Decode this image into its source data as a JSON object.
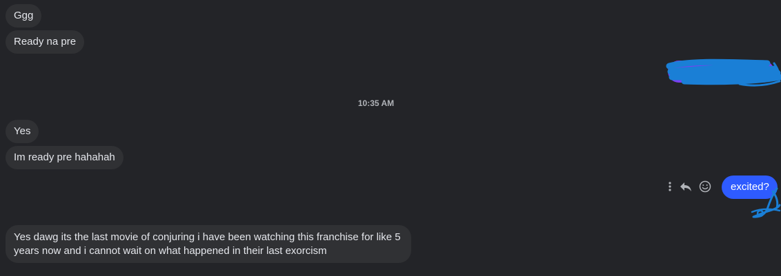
{
  "conversation": {
    "messages": [
      {
        "direction": "incoming",
        "text": "Ggg"
      },
      {
        "direction": "incoming",
        "text": "Ready na pre"
      },
      {
        "direction": "outgoing",
        "text": ""
      },
      {
        "direction": "incoming",
        "text": "Yes"
      },
      {
        "direction": "incoming",
        "text": "Im ready pre hahahah"
      },
      {
        "direction": "outgoing",
        "text": "excited?"
      },
      {
        "direction": "incoming",
        "text": "Yes dawg its the last movie of conjuring i have been watching this franchise for like 5 years now and i cannot wait on what happened in their last exorcism"
      }
    ],
    "timestamp": "10:35 AM"
  },
  "message_actions": {
    "icons": [
      "more-options-icon",
      "reply-icon",
      "react-emoji-icon"
    ]
  },
  "colors": {
    "background": "#232428",
    "incoming_bubble": "#303134",
    "outgoing_bubble": "#2e5bff",
    "scribble": "#1a7fd6"
  }
}
